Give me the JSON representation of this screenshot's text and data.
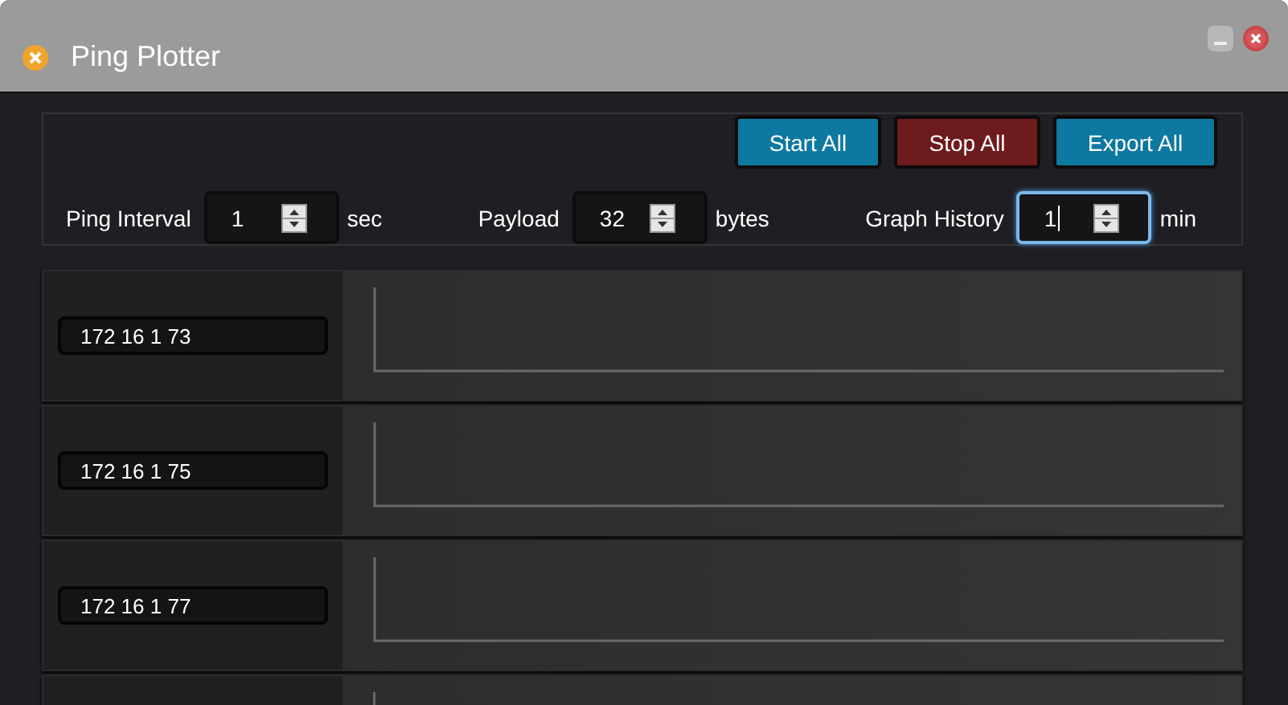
{
  "window": {
    "title": "Ping Plotter"
  },
  "toolbar": {
    "buttons": [
      {
        "label": "Start All",
        "kind": "start"
      },
      {
        "label": "Stop All",
        "kind": "stop"
      },
      {
        "label": "Export All",
        "kind": "export"
      }
    ]
  },
  "settings": [
    {
      "label": "Ping Interval",
      "value": "1",
      "unit": "sec",
      "focused": false
    },
    {
      "label": "Payload",
      "value": "32",
      "unit": "bytes",
      "focused": false
    },
    {
      "label": "Graph History",
      "value": "1",
      "unit": "min",
      "focused": true
    }
  ],
  "rows": [
    {
      "kind": "host",
      "host": "172 16 1 73"
    },
    {
      "kind": "host",
      "host": "172 16 1 75"
    },
    {
      "kind": "host",
      "host": "172 16 1 77"
    },
    {
      "kind": "blank"
    }
  ]
}
